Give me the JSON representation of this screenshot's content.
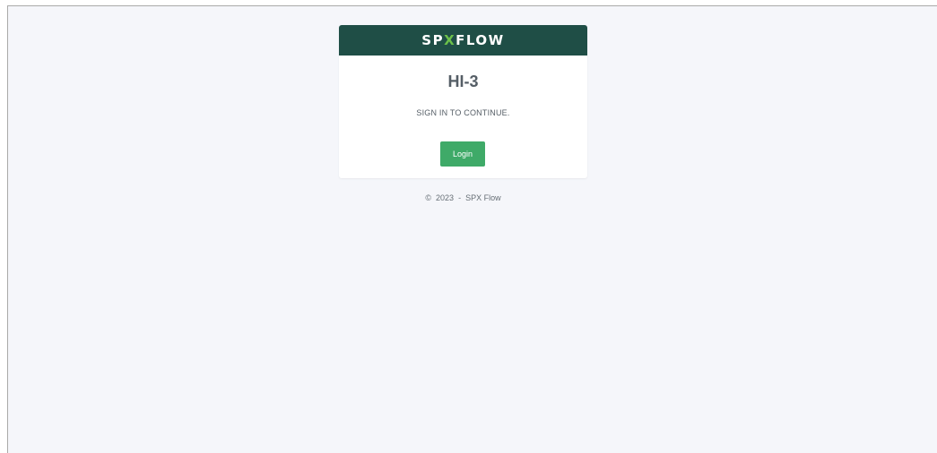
{
  "header": {
    "logo_part1": "SP",
    "logo_x": "X",
    "logo_part2": "FLOW",
    "brand_color": "#1f4e46",
    "logo_accent_color": "#6cc04a"
  },
  "card": {
    "title": "HI-3",
    "subtitle": "SIGN IN TO CONTINUE.",
    "login_label": "Login",
    "button_color": "#3faa68"
  },
  "footer": {
    "copyright_symbol": "©",
    "year": "2023",
    "separator": "-",
    "company": "SPX Flow"
  }
}
